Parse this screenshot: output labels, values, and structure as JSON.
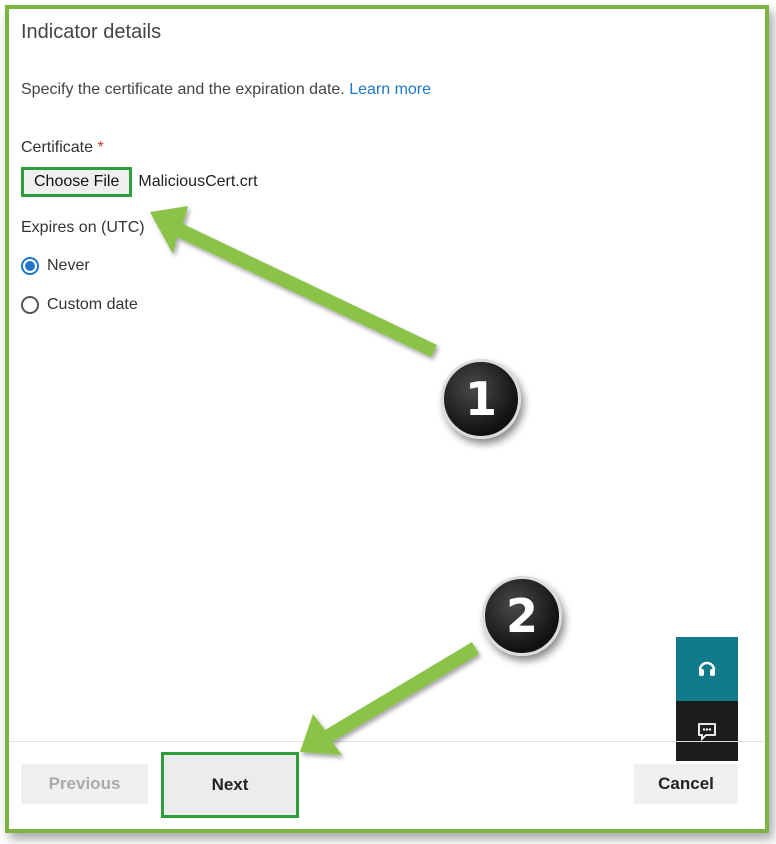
{
  "panel": {
    "title": "Indicator details",
    "description": "Specify the certificate and the expiration date. ",
    "learn_more": "Learn more"
  },
  "certificate": {
    "label": "Certificate",
    "required_mark": "*",
    "choose_file_label": "Choose File",
    "file_name": "MaliciousCert.crt"
  },
  "expires": {
    "label": "Expires on (UTC)",
    "options": [
      {
        "label": "Never",
        "checked": true
      },
      {
        "label": "Custom date",
        "checked": false
      }
    ]
  },
  "footer": {
    "previous_label": "Previous",
    "next_label": "Next",
    "cancel_label": "Cancel"
  },
  "side_buttons": {
    "help_icon": "headset-icon",
    "feedback_icon": "feedback-icon"
  },
  "annotations": {
    "step1": "1",
    "step2": "2",
    "highlight_color": "#2e9e3a",
    "arrow_color": "#8bc34a"
  },
  "colors": {
    "frame_border": "#7cb342",
    "link": "#1f77c9",
    "help_bg": "#117a8b",
    "feedback_bg": "#1c1c1c"
  }
}
